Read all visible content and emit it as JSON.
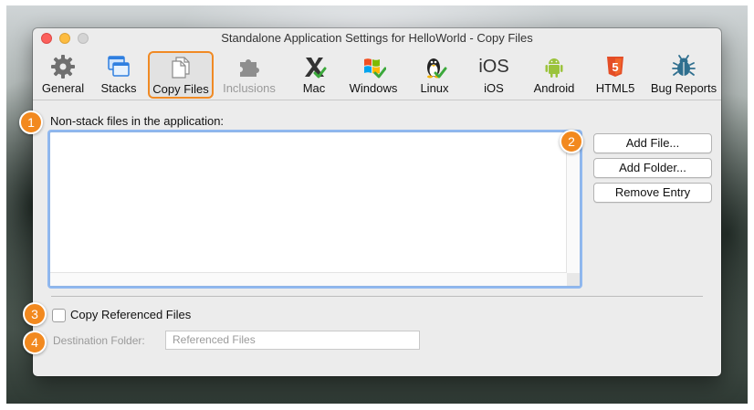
{
  "window": {
    "title": "Standalone Application Settings for HelloWorld - Copy Files"
  },
  "toolbar": {
    "items": [
      {
        "label": "General",
        "icon": "gear-icon"
      },
      {
        "label": "Stacks",
        "icon": "windows-stack-icon"
      },
      {
        "label": "Copy Files",
        "icon": "documents-icon",
        "selected": true
      },
      {
        "label": "Inclusions",
        "icon": "puzzle-piece-icon",
        "disabled": true
      },
      {
        "label": "Mac",
        "icon": "mac-x-icon"
      },
      {
        "label": "Windows",
        "icon": "windows-flag-icon"
      },
      {
        "label": "Linux",
        "icon": "linux-penguin-icon"
      },
      {
        "label": "iOS",
        "icon": "ios-icon",
        "glyph": "iOS"
      },
      {
        "label": "Android",
        "icon": "android-icon"
      },
      {
        "label": "HTML5",
        "icon": "html5-icon",
        "glyph": "5"
      },
      {
        "label": "Bug Reports",
        "icon": "bug-icon"
      }
    ]
  },
  "files": {
    "label": "Non-stack files in the application:",
    "buttons": {
      "add_file": "Add File...",
      "add_folder": "Add Folder...",
      "remove_entry": "Remove Entry"
    }
  },
  "options": {
    "copy_referenced_label": "Copy Referenced Files",
    "copy_referenced_checked": false,
    "destination_label": "Destination Folder:",
    "destination_placeholder": "Referenced Files"
  },
  "callouts": [
    "1",
    "2",
    "3",
    "4"
  ],
  "colors": {
    "accent": "#f08a24",
    "focus_ring": "#8fb8f0",
    "badge": "#f2891f"
  }
}
